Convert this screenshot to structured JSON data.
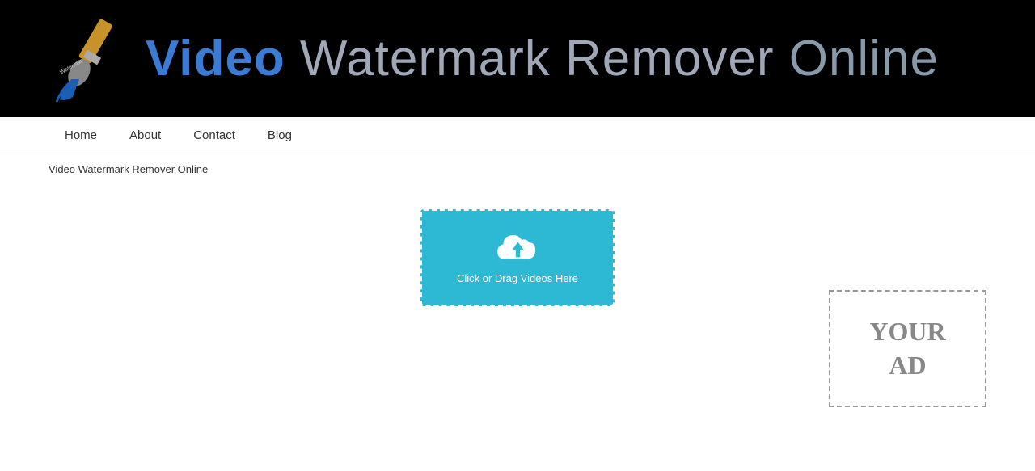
{
  "header": {
    "logo_text": "Video Watermark Remover Online",
    "logo_video": "Video",
    "logo_middle": " Watermark Remover ",
    "logo_online": "Online"
  },
  "nav": {
    "items": [
      {
        "label": "Home",
        "id": "home"
      },
      {
        "label": "About",
        "id": "about"
      },
      {
        "label": "Contact",
        "id": "contact"
      },
      {
        "label": "Blog",
        "id": "blog"
      }
    ]
  },
  "breadcrumb": {
    "text": "Video Watermark Remover Online"
  },
  "upload": {
    "label": "Click or Drag Videos Here"
  },
  "ad": {
    "line1": "YOUR",
    "line2": "AD"
  }
}
